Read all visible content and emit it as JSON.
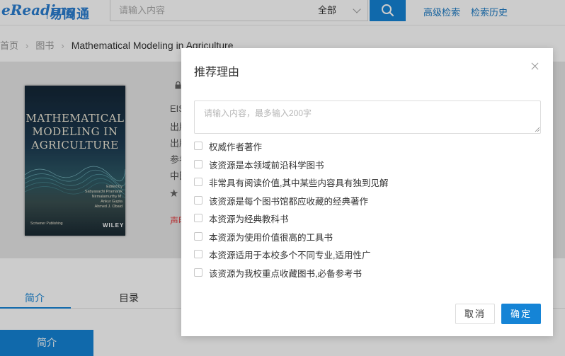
{
  "header": {
    "logo_en": "eReading",
    "logo_cn": "易阅通",
    "search_placeholder": "请输入内容",
    "search_scope": "全部",
    "links": [
      "高级检索",
      "检索历史"
    ]
  },
  "breadcrumb": {
    "items": [
      "首页",
      "图书"
    ],
    "current": "Mathematical Modeling in Agriculture"
  },
  "book": {
    "cover_title_lines": [
      "MATHEMATICAL",
      "MODELING IN",
      "AGRICULTURE"
    ],
    "cover_authors": [
      "Edited by",
      "Sabyasachi Pramanik",
      "Nirmalamurthy M.",
      "Ankur Gupta",
      "Ahmed J. Obaid"
    ],
    "cover_publisher": "Scrivener Publishing",
    "cover_wiley": "WILEY",
    "meta_fragments": [
      "EIS",
      "出版",
      "出版",
      "参考",
      "中图"
    ],
    "red_fragment": "声明"
  },
  "tabs": [
    "简介",
    "目录"
  ],
  "section_label": "简介",
  "modal": {
    "title": "推荐理由",
    "textarea_placeholder": "请输入内容，最多输入200字",
    "reasons": [
      "权威作者著作",
      "该资源是本领域前沿科学图书",
      "非常具有阅读价值,其中某些内容具有独到见解",
      "该资源是每个图书馆都应收藏的经典著作",
      "本资源为经典教科书",
      "本资源为使用价值很高的工具书",
      "本资源适用于本校多个不同专业,适用性广",
      "该资源为我校重点收藏图书,必备参考书"
    ],
    "cancel_label": "取消",
    "ok_label": "确定"
  },
  "colors": {
    "primary": "#1584d6",
    "accent_red": "#e4393c",
    "band_gray": "#e8e8e8"
  }
}
